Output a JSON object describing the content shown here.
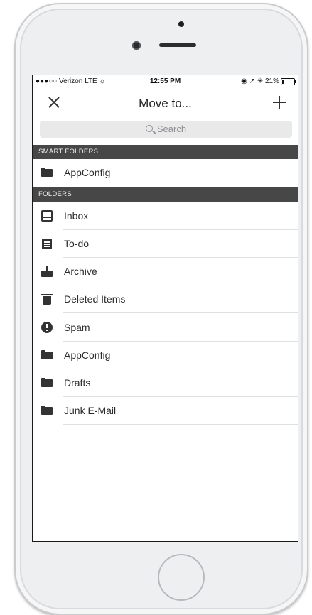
{
  "status_bar": {
    "carrier": "●●●○○ Verizon  LTE ☼",
    "time": "12:55 PM",
    "right_status": "◉ ↗ ✳ 21%",
    "battery_level": 0.21
  },
  "nav": {
    "title": "Move to...",
    "close_icon": "close-icon",
    "add_icon": "add-icon"
  },
  "search": {
    "placeholder": "Search",
    "icon": "search-icon"
  },
  "sections": {
    "smart_folders": {
      "header": "SMART FOLDERS",
      "items": [
        {
          "label": "AppConfig",
          "icon": "folder-icon"
        }
      ]
    },
    "folders": {
      "header": "FOLDERS",
      "items": [
        {
          "label": "Inbox",
          "icon": "inbox-icon"
        },
        {
          "label": "To-do",
          "icon": "todo-icon"
        },
        {
          "label": "Archive",
          "icon": "archive-icon"
        },
        {
          "label": "Deleted Items",
          "icon": "trash-icon"
        },
        {
          "label": "Spam",
          "icon": "spam-icon"
        },
        {
          "label": "AppConfig",
          "icon": "folder-icon"
        },
        {
          "label": "Drafts",
          "icon": "folder-icon"
        },
        {
          "label": "Junk E-Mail",
          "icon": "folder-icon"
        }
      ]
    }
  }
}
